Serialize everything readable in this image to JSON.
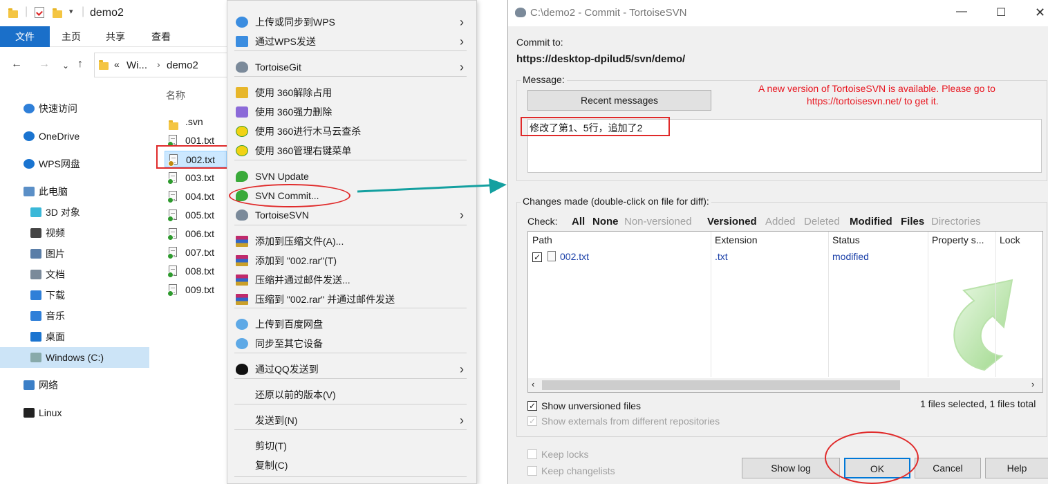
{
  "explorer": {
    "window_title": "demo2",
    "ribbon_tabs": [
      "文件",
      "主页",
      "共享",
      "查看"
    ],
    "address_parts": [
      "Wi...",
      "demo2"
    ],
    "address_prefix": "«",
    "column_header": "名称",
    "nav_items": [
      {
        "label": "快速访问",
        "icon": "star-icon"
      },
      {
        "label": "OneDrive",
        "icon": "cloud-icon"
      },
      {
        "label": "WPS网盘",
        "icon": "cloud-icon"
      },
      {
        "label": "此电脑",
        "icon": "computer-icon"
      },
      {
        "label": "3D 对象",
        "icon": "cube-icon"
      },
      {
        "label": "视频",
        "icon": "video-icon"
      },
      {
        "label": "图片",
        "icon": "picture-icon"
      },
      {
        "label": "文档",
        "icon": "document-icon"
      },
      {
        "label": "下载",
        "icon": "download-icon"
      },
      {
        "label": "音乐",
        "icon": "music-icon"
      },
      {
        "label": "桌面",
        "icon": "desktop-icon"
      },
      {
        "label": "Windows (C:)",
        "icon": "drive-icon"
      },
      {
        "label": "网络",
        "icon": "network-icon"
      },
      {
        "label": "Linux",
        "icon": "linux-icon"
      }
    ],
    "files": [
      ".svn",
      "001.txt",
      "002.txt",
      "003.txt",
      "004.txt",
      "005.txt",
      "006.txt",
      "007.txt",
      "008.txt",
      "009.txt"
    ],
    "selected_file": "002.txt"
  },
  "context_menu": {
    "items": [
      {
        "label": "上传或同步到WPS",
        "icon": "wps-cloud-icon",
        "submenu": true
      },
      {
        "label": "通过WPS发送",
        "icon": "wps-send-icon",
        "submenu": true
      },
      {
        "label": "TortoiseGit",
        "icon": "tortoisegit-icon",
        "submenu": true
      },
      {
        "label": "使用 360解除占用",
        "icon": "unlock-360-icon",
        "submenu": false
      },
      {
        "label": "使用 360强力删除",
        "icon": "delete-360-icon",
        "submenu": false
      },
      {
        "label": "使用 360进行木马云查杀",
        "icon": "scan-360-icon",
        "submenu": false
      },
      {
        "label": "使用 360管理右键菜单",
        "icon": "menu-360-icon",
        "submenu": false
      },
      {
        "label": "SVN Update",
        "icon": "svn-update-icon",
        "submenu": false
      },
      {
        "label": "SVN Commit...",
        "icon": "svn-commit-icon",
        "submenu": false
      },
      {
        "label": "TortoiseSVN",
        "icon": "tortoisesvn-icon",
        "submenu": true
      },
      {
        "label": "添加到压缩文件(A)...",
        "icon": "rar-icon",
        "submenu": false
      },
      {
        "label": "添加到 \"002.rar\"(T)",
        "icon": "rar-icon",
        "submenu": false
      },
      {
        "label": "压缩并通过邮件发送...",
        "icon": "rar-icon",
        "submenu": false
      },
      {
        "label": "压缩到 \"002.rar\" 并通过邮件发送",
        "icon": "rar-icon",
        "submenu": false
      },
      {
        "label": "上传到百度网盘",
        "icon": "baidu-icon",
        "submenu": false
      },
      {
        "label": "同步至其它设备",
        "icon": "baidu-icon",
        "submenu": false
      },
      {
        "label": "通过QQ发送到",
        "icon": "qq-icon",
        "submenu": true
      },
      {
        "label": "还原以前的版本(V)",
        "icon": "",
        "submenu": false
      },
      {
        "label": "发送到(N)",
        "icon": "",
        "submenu": true
      },
      {
        "label": "剪切(T)",
        "icon": "",
        "submenu": false
      },
      {
        "label": "复制(C)",
        "icon": "",
        "submenu": false
      }
    ]
  },
  "dialog": {
    "title": "C:\\demo2 - Commit - TortoiseSVN",
    "commit_to_label": "Commit to:",
    "commit_url": "https://desktop-dpilud5/svn/demo/",
    "message_label": "Message:",
    "recent_messages_button": "Recent messages",
    "update_notice_line1": "A new version of TortoiseSVN is available. Please go to",
    "update_notice_line2": "https://tortoisesvn.net/ to get it.",
    "message_text": "修改了第1、5行，追加了2",
    "changes_label": "Changes made (double-click on file for diff):",
    "check_label": "Check:",
    "check_filters": [
      {
        "label": "All",
        "enabled": true
      },
      {
        "label": "None",
        "enabled": true
      },
      {
        "label": "Non-versioned",
        "enabled": false
      },
      {
        "label": "Versioned",
        "enabled": true
      },
      {
        "label": "Added",
        "enabled": false
      },
      {
        "label": "Deleted",
        "enabled": false
      },
      {
        "label": "Modified",
        "enabled": true
      },
      {
        "label": "Files",
        "enabled": true
      },
      {
        "label": "Directories",
        "enabled": false
      }
    ],
    "columns": [
      "Path",
      "Extension",
      "Status",
      "Property s...",
      "Lock"
    ],
    "rows": [
      {
        "path": "002.txt",
        "extension": ".txt",
        "status": "modified",
        "checked": true
      }
    ],
    "show_unversioned": "Show unversioned files",
    "show_externals": "Show externals from different repositories",
    "selection_summary": "1 files selected, 1 files total",
    "keep_locks": "Keep locks",
    "keep_changelists": "Keep changelists",
    "buttons": {
      "show_log": "Show log",
      "ok": "OK",
      "cancel": "Cancel",
      "help": "Help"
    }
  },
  "colors": {
    "highlight_red": "#e02a2a",
    "accent_blue": "#1a6fc9",
    "arrow_teal": "#14a0a0",
    "notice_red": "#e8141e"
  }
}
